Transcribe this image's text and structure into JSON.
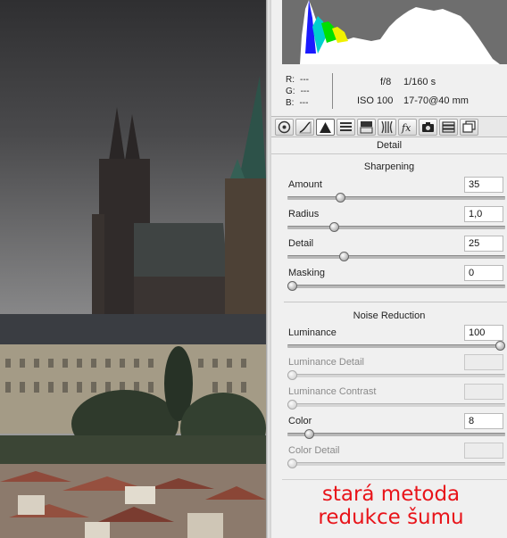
{
  "readout": {
    "r_label": "R:",
    "g_label": "G:",
    "b_label": "B:",
    "r_value": "---",
    "g_value": "---",
    "b_value": "---",
    "aperture": "f/8",
    "shutter": "1/160 s",
    "iso": "ISO 100",
    "lens": "17-70@40 mm"
  },
  "toolbar": {
    "icons": [
      "basic-icon",
      "tone-curve-icon",
      "detail-icon",
      "hsl-icon",
      "split-toning-icon",
      "lens-corrections-icon",
      "effects-icon",
      "camera-calibration-icon",
      "presets-icon",
      "snapshots-icon"
    ],
    "active_icon": "detail-icon"
  },
  "panel": {
    "section_title": "Detail"
  },
  "sharpening": {
    "title": "Sharpening",
    "amount": {
      "label": "Amount",
      "value": "35",
      "level": 0.233
    },
    "radius": {
      "label": "Radius",
      "value": "1,0",
      "level": 0.2
    },
    "detail": {
      "label": "Detail",
      "value": "25",
      "level": 0.25
    },
    "masking": {
      "label": "Masking",
      "value": "0",
      "level": 0.0
    }
  },
  "noise_reduction": {
    "title": "Noise Reduction",
    "luminance": {
      "label": "Luminance",
      "value": "100",
      "level": 1.0
    },
    "luminance_detail": {
      "label": "Luminance Detail",
      "value": "",
      "level": 0.0
    },
    "luminance_contrast": {
      "label": "Luminance Contrast",
      "value": "",
      "level": 0.0
    },
    "color": {
      "label": "Color",
      "value": "8",
      "level": 0.08
    },
    "color_detail": {
      "label": "Color Detail",
      "value": "",
      "level": 0.0
    }
  },
  "caption": {
    "line1": "stará metoda",
    "line2": "redukce šumu"
  },
  "colors": {
    "caption": "#e8141a",
    "panel_bg": "#f0f0f0",
    "histogram_bg": "#6e6e6e"
  }
}
